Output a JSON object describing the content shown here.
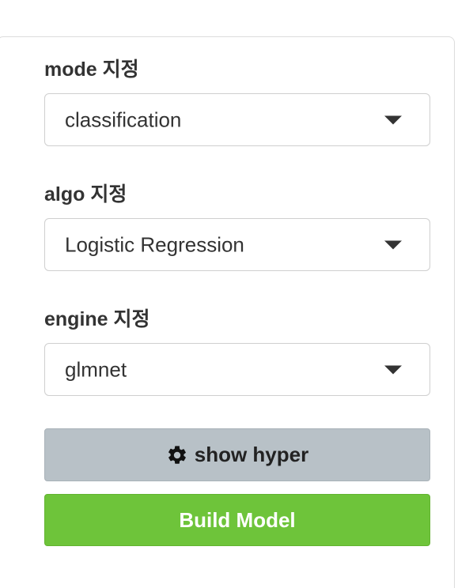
{
  "form": {
    "mode": {
      "label": "mode 지정",
      "value": "classification"
    },
    "algo": {
      "label": "algo 지정",
      "value": "Logistic Regression"
    },
    "engine": {
      "label": "engine 지정",
      "value": "glmnet"
    }
  },
  "buttons": {
    "show_hyper": {
      "label": "show hyper",
      "icon": "gear-icon",
      "color": "#b8c1c7"
    },
    "build_model": {
      "label": "Build Model",
      "color": "#6ec43a"
    }
  }
}
